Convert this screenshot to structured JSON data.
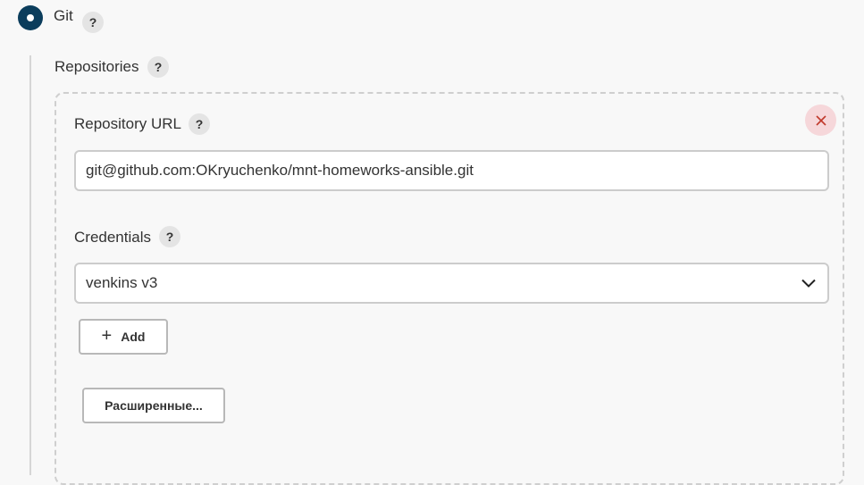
{
  "scm": {
    "option_label": "Git",
    "help": "?"
  },
  "repositories": {
    "label": "Repositories",
    "help": "?",
    "delete_icon": "close-icon",
    "url_field": {
      "label": "Repository URL",
      "help": "?",
      "value": "git@github.com:OKryuchenko/mnt-homeworks-ansible.git"
    },
    "credentials": {
      "label": "Credentials",
      "help": "?",
      "selected": "venkins v3"
    },
    "add_button": {
      "icon": "+",
      "label": "Add"
    },
    "advanced_button": {
      "label": "Расширенные..."
    }
  },
  "colors": {
    "radio_selected": "#0b3d5c",
    "delete_bg": "#f6d7da",
    "delete_fg": "#c0392b",
    "page_bg": "#f8f8f8"
  }
}
